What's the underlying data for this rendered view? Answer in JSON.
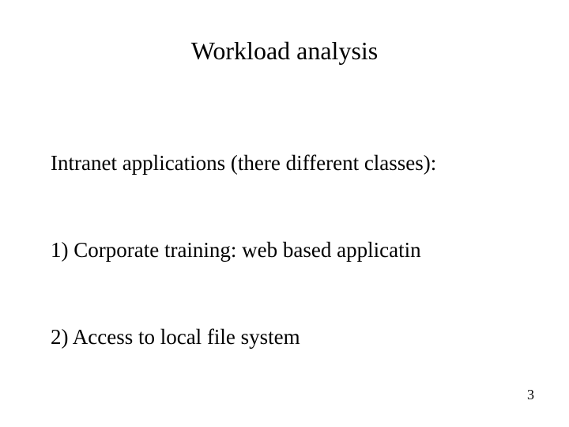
{
  "title": "Workload analysis",
  "intro": "Intranet applications (there different classes):",
  "items": [
    "1)  Corporate training: web based applicatin",
    "2)  Access to local file system"
  ],
  "pageNumber": "3"
}
